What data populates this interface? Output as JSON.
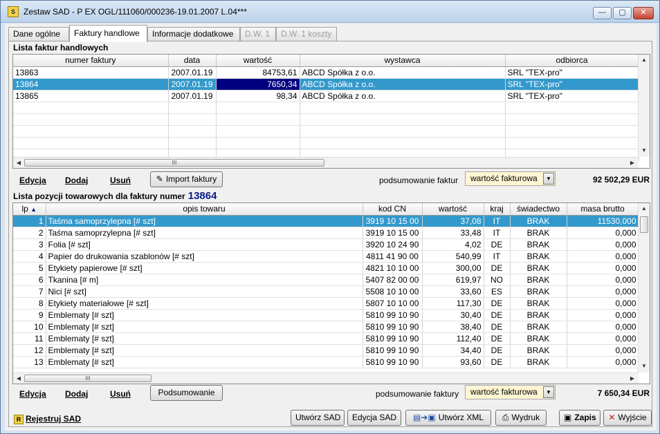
{
  "window": {
    "title": "Zestaw SAD - P EX OGL/111060/000236-19.01.2007 L.04***",
    "icon": "S"
  },
  "tabs": [
    {
      "label": "Dane ogólne",
      "state": "normal"
    },
    {
      "label": "Faktury handlowe",
      "state": "active"
    },
    {
      "label": "Informacje dodatkowe",
      "state": "normal"
    },
    {
      "label": "D.W. 1",
      "state": "disabled"
    },
    {
      "label": "D.W. 1  koszty",
      "state": "disabled"
    }
  ],
  "invoices": {
    "title": "Lista faktur handlowych",
    "columns": [
      "numer faktury",
      "data",
      "wartość",
      "wystawca",
      "odbiorca"
    ],
    "rows": [
      [
        "13863",
        "2007.01.19",
        "84753,61",
        "ABCD Spółka z o.o.",
        "SRL \"TEX-pro\""
      ],
      [
        "13864",
        "2007.01.19",
        "7650,34",
        "ABCD Spółka z o.o.",
        "SRL \"TEX-pro\""
      ],
      [
        "13865",
        "2007.01.19",
        "98,34",
        "ABCD Spółka z o.o.",
        "SRL \"TEX-pro\""
      ]
    ],
    "selected_row": 1,
    "actions": {
      "edit": "Edycja",
      "add": "Dodaj",
      "delete": "Usuń",
      "import": "Import faktury"
    },
    "summary_label": "podsumowanie faktur",
    "summary_mode": "wartość fakturowa",
    "total": "92 502,29 EUR"
  },
  "items": {
    "title": "Lista pozycji towarowych dla faktury numer",
    "invoice_number": "13864",
    "columns": [
      "lp",
      "opis towaru",
      "kod CN",
      "wartość",
      "kraj",
      "świadectwo",
      "masa brutto"
    ],
    "rows": [
      [
        "1",
        "Taśma samoprzylepna [# szt]",
        "3919 10 15 00",
        "37,08",
        "IT",
        "BRAK",
        "11530,000"
      ],
      [
        "2",
        "Taśma samoprzylepna [# szt]",
        "3919 10 15 00",
        "33,48",
        "IT",
        "BRAK",
        "0,000"
      ],
      [
        "3",
        "Folia [# szt]",
        "3920 10 24 90",
        "4,02",
        "DE",
        "BRAK",
        "0,000"
      ],
      [
        "4",
        "Papier do drukowania szablonów [# szt]",
        "4811 41 90 00",
        "540,99",
        "IT",
        "BRAK",
        "0,000"
      ],
      [
        "5",
        "Etykiety papierowe [# szt]",
        "4821 10 10 00",
        "300,00",
        "DE",
        "BRAK",
        "0,000"
      ],
      [
        "6",
        "Tkanina [# m]",
        "5407 82 00 00",
        "619,97",
        "NO",
        "BRAK",
        "0,000"
      ],
      [
        "7",
        "Nici [# szt]",
        "5508 10 10 00",
        "33,60",
        "ES",
        "BRAK",
        "0,000"
      ],
      [
        "8",
        "Etykiety materiałowe [# szt]",
        "5807 10 10 00",
        "117,30",
        "DE",
        "BRAK",
        "0,000"
      ],
      [
        "9",
        "Emblematy [# szt]",
        "5810 99 10 90",
        "30,40",
        "DE",
        "BRAK",
        "0,000"
      ],
      [
        "10",
        "Emblematy [# szt]",
        "5810 99 10 90",
        "38,40",
        "DE",
        "BRAK",
        "0,000"
      ],
      [
        "11",
        "Emblematy [# szt]",
        "5810 99 10 90",
        "112,40",
        "DE",
        "BRAK",
        "0,000"
      ],
      [
        "12",
        "Emblematy [# szt]",
        "5810 99 10 90",
        "34,40",
        "DE",
        "BRAK",
        "0,000"
      ],
      [
        "13",
        "Emblematy [# szt]",
        "5810 99 10 90",
        "93,60",
        "DE",
        "BRAK",
        "0,000"
      ]
    ],
    "selected_row": 0,
    "actions": {
      "edit": "Edycja",
      "add": "Dodaj",
      "delete": "Usuń",
      "summary": "Podsumowanie"
    },
    "summary_label": "podsumowanie faktury",
    "summary_mode": "wartość fakturowa",
    "total": "7 650,34 EUR"
  },
  "footer": {
    "register": "Rejestruj SAD",
    "create_sad": "Utwórz SAD",
    "edit_sad": "Edycja SAD",
    "create_xml": "Utwórz XML",
    "print": "Wydruk",
    "save": "Zapis",
    "exit": "Wyjście"
  },
  "colors": {
    "selection": "#3399cc",
    "current_cell": "#000080",
    "combo_bg": "#fdf5d3",
    "invoice_number": "#0a1d86"
  }
}
